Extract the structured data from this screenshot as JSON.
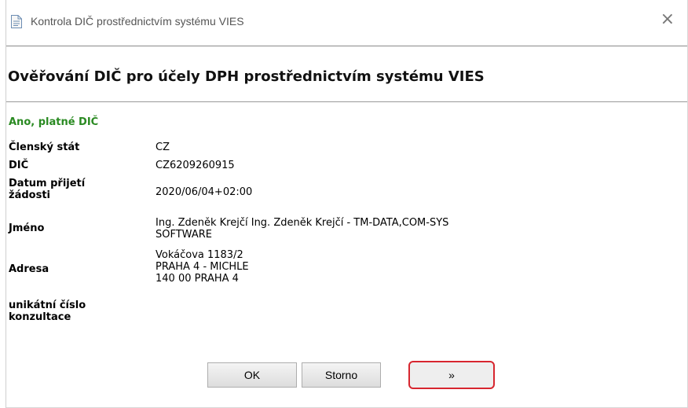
{
  "window": {
    "title": "Kontrola DIČ prostřednictvím systému VIES",
    "close_glyph": "×"
  },
  "heading": "Ověřování DIČ pro účely DPH prostřednictvím systému VIES",
  "status": "Ano, platné DIČ",
  "rows": [
    {
      "label": "Členský stát",
      "value": "CZ"
    },
    {
      "label": "DIČ",
      "value": "CZ6209260915"
    },
    {
      "label": "Datum přijetí žádosti",
      "value": "2020/06/04+02:00"
    },
    {
      "label": "Jméno",
      "value": "Ing. Zdeněk Krejčí Ing. Zdeněk Krejčí - TM-DATA,COM-SYS SOFTWARE"
    },
    {
      "label": "Adresa",
      "value": "Vokáčova 1183/2\nPRAHA 4 - MICHLE\n140 00 PRAHA 4"
    },
    {
      "label": "unikátní číslo konzultace",
      "value": ""
    }
  ],
  "buttons": {
    "ok": "OK",
    "cancel": "Storno",
    "more": "»"
  },
  "icons": {
    "title": "document-icon",
    "close": "close-icon"
  },
  "colors": {
    "status": "#2a8a22",
    "highlight": "#d7262f"
  }
}
